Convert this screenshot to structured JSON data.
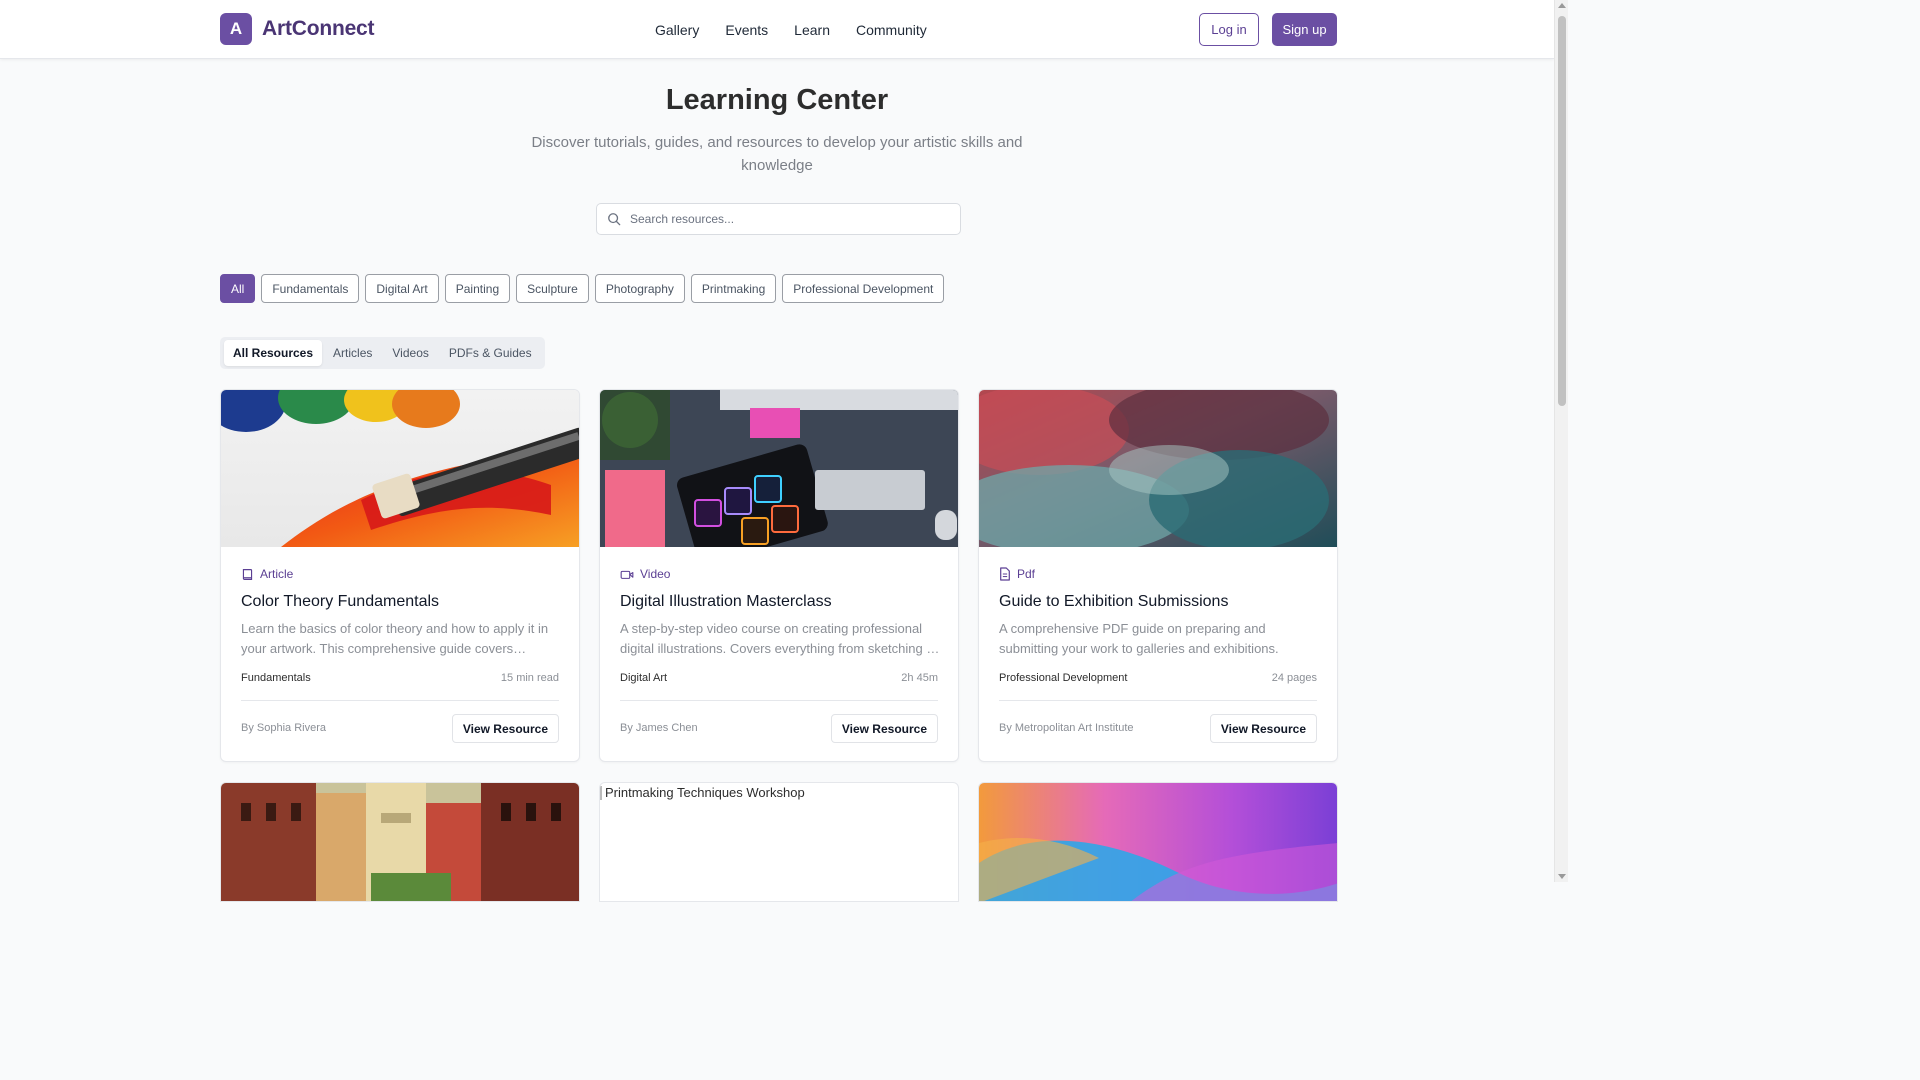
{
  "brand": {
    "logo_letter": "A",
    "name": "ArtConnect",
    "accent_color": "#6b4fa3"
  },
  "nav": {
    "items": [
      "Gallery",
      "Events",
      "Learn",
      "Community"
    ]
  },
  "auth": {
    "login_label": "Log in",
    "signup_label": "Sign up"
  },
  "hero": {
    "title": "Learning Center",
    "subtitle": "Discover tutorials, guides, and resources to develop your artistic skills and knowledge"
  },
  "search": {
    "placeholder": "Search resources..."
  },
  "categories": {
    "selected": "All",
    "items": [
      "All",
      "Fundamentals",
      "Digital Art",
      "Painting",
      "Sculpture",
      "Photography",
      "Printmaking",
      "Professional Development"
    ]
  },
  "resource_tabs": {
    "selected": "All Resources",
    "items": [
      "All Resources",
      "Articles",
      "Videos",
      "PDFs & Guides"
    ]
  },
  "cards": [
    {
      "type_icon": "book-icon",
      "type": "Article",
      "title": "Color Theory Fundamentals",
      "description": "Learn the basics of color theory and how to apply it in your artwork. This comprehensive guide covers primary, secondary and tertiary colors.",
      "category": "Fundamentals",
      "meta": "15 min read",
      "author": "By Sophia Rivera",
      "button": "View Resource"
    },
    {
      "type_icon": "video-icon",
      "type": "Video",
      "title": "Digital Illustration Masterclass",
      "description": "A step-by-step video course on creating professional digital illustrations. Covers everything from sketching to final rendering.",
      "category": "Digital Art",
      "meta": "2h 45m",
      "author": "By James Chen",
      "button": "View Resource"
    },
    {
      "type_icon": "file-text-icon",
      "type": "Pdf",
      "title": "Guide to Exhibition Submissions",
      "description": "A comprehensive PDF guide on preparing and submitting your work to galleries and exhibitions.",
      "category": "Professional Development",
      "meta": "24 pages",
      "author": "By Metropolitan Art Institute",
      "button": "View Resource"
    }
  ],
  "partial_cards": {
    "broken_image_alt": "Printmaking Techniques Workshop"
  }
}
